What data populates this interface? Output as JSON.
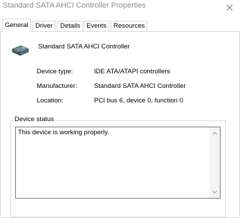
{
  "window": {
    "title": "Standard SATA AHCI Controller Properties"
  },
  "tabs": [
    {
      "label": "General"
    },
    {
      "label": "Driver"
    },
    {
      "label": "Details"
    },
    {
      "label": "Events"
    },
    {
      "label": "Resources"
    }
  ],
  "device": {
    "name": "Standard SATA AHCI Controller",
    "icon": "storage-controller-icon"
  },
  "properties": [
    {
      "label": "Device type:",
      "value": "IDE ATA/ATAPI controllers"
    },
    {
      "label": "Manufacturer:",
      "value": "Standard SATA AHCI Controller"
    },
    {
      "label": "Location:",
      "value": "PCI bus 6, device 0, function 0"
    }
  ],
  "status": {
    "caption": "Device status",
    "text": "This device is working properly."
  },
  "colors": {
    "title_text": "#8c8c8c",
    "tab_border": "#d9d9d9"
  }
}
